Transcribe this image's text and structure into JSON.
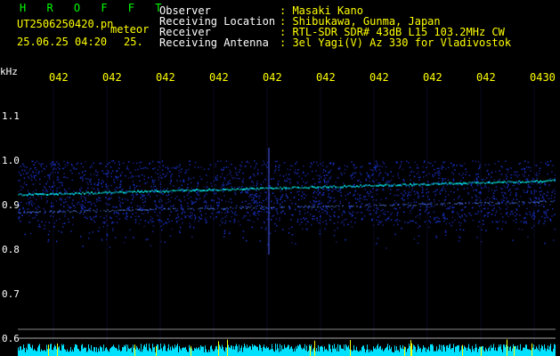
{
  "header": {
    "app_title": "H R O F F T",
    "file_name": "UT2506250420.pn",
    "file_tag": "meteor",
    "timestamp": "25.06.25 04:20",
    "count": "25.",
    "fields": [
      {
        "label": "Observer",
        "value": ": Masaki Kano"
      },
      {
        "label": "Receiving Location",
        "value": ": Shibukawa, Gunma, Japan"
      },
      {
        "label": "Receiver",
        "value": ": RTL-SDR SDR# 43dB L15 103.2MHz CW"
      },
      {
        "label": "Receiving Antenna",
        "value": ": 3el Yagi(V) Az 330 for Vladivostok"
      }
    ]
  },
  "axis": {
    "y_unit": "kHz",
    "y_ticks": [
      "1.1",
      "1.0",
      "0.9",
      "0.8",
      "0.7",
      "0.6"
    ],
    "x_ticks": [
      "042",
      "042",
      "042",
      "042",
      "042",
      "042",
      "042",
      "042",
      "042",
      "0430"
    ]
  },
  "colors": {
    "background": "#000000",
    "title": "#00ff00",
    "header_value": "#ffff00",
    "signal_strong": "#00ffff",
    "noise": "#1a2a9a",
    "spectrum_fill": "#00e0ff",
    "spike": "#ffff00"
  }
}
